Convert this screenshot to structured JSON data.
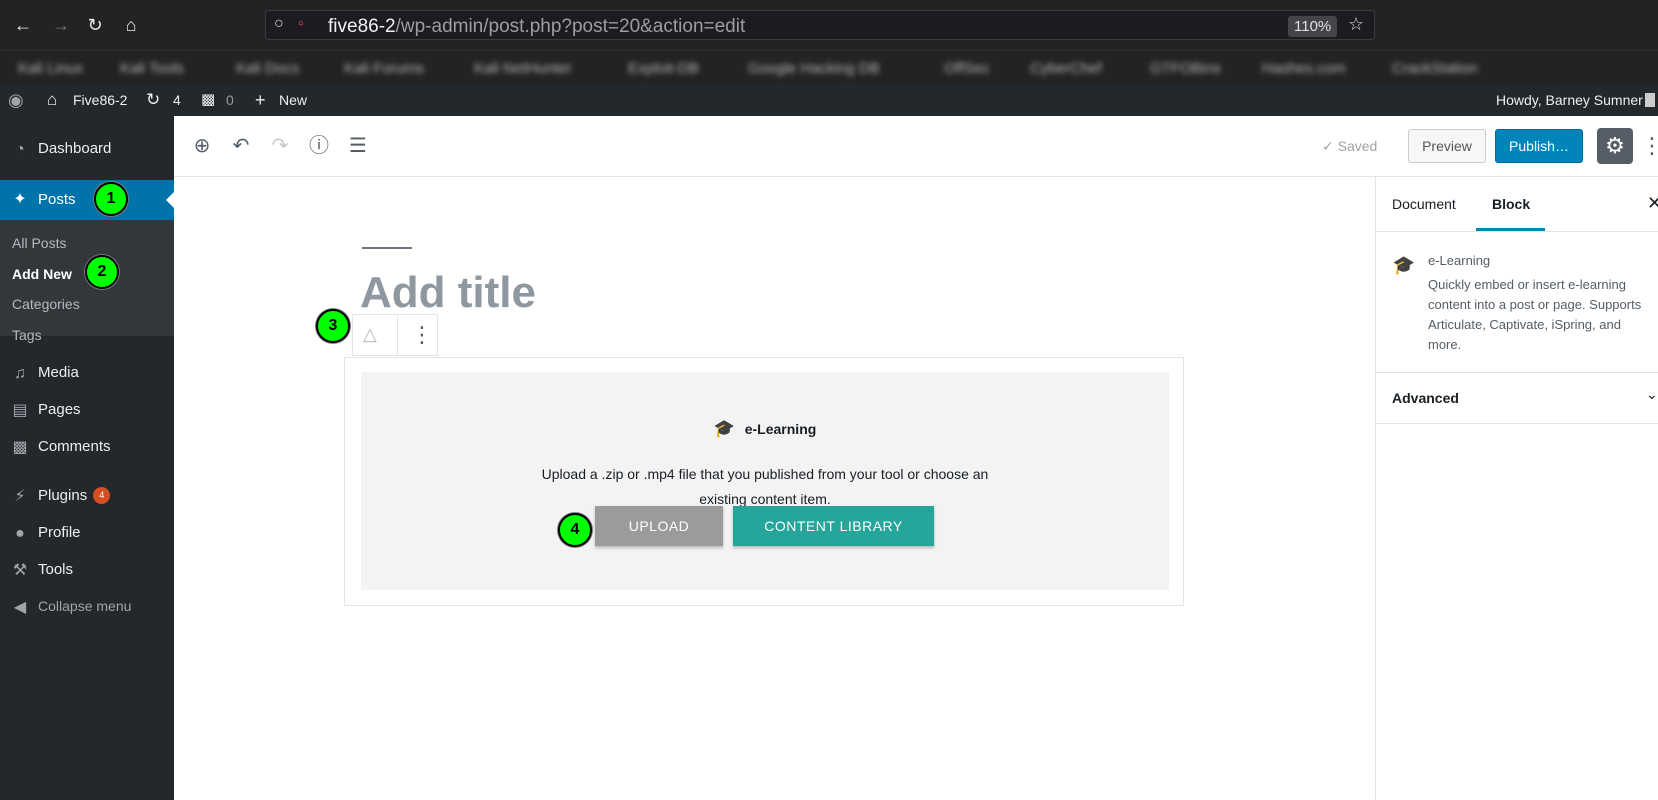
{
  "browser": {
    "url_host": "five86-2",
    "url_path": "/wp-admin/post.php?post=20&action=edit",
    "zoom": "110%",
    "bookmarks": [
      "Kali Linux",
      "Kali Tools",
      "Kali Docs",
      "Kali Forums",
      "Kali NetHunter",
      "Exploit-DB",
      "Google Hacking DB",
      "OffSec",
      "CyberChef",
      "GTFOBins",
      "Hashes.com",
      "CrackStation"
    ]
  },
  "adminbar": {
    "site_name": "Five86-2",
    "updates_count": "4",
    "comments_count": "0",
    "new_label": "New",
    "greeting": "Howdy, Barney Sumner"
  },
  "sidebar": {
    "dashboard": "Dashboard",
    "posts": "Posts",
    "submenu": [
      "All Posts",
      "Add New",
      "Categories",
      "Tags"
    ],
    "media": "Media",
    "pages": "Pages",
    "comments": "Comments",
    "plugins": "Plugins",
    "plugins_count": "4",
    "profile": "Profile",
    "tools": "Tools",
    "collapse": "Collapse menu"
  },
  "markers": [
    "1",
    "2",
    "3",
    "4"
  ],
  "toolbar": {
    "saved": "Saved",
    "preview": "Preview",
    "publish": "Publish…"
  },
  "editor": {
    "title_placeholder": "Add title",
    "block": {
      "name": "e-Learning",
      "description": "Upload a .zip or .mp4 file that you published from your tool or choose an existing content item.",
      "upload_label": "UPLOAD",
      "library_label": "CONTENT LIBRARY"
    }
  },
  "settings_panel": {
    "tab_document": "Document",
    "tab_block": "Block",
    "block_title": "e-Learning",
    "block_description_lines": [
      "Quickly embed or insert e-learning",
      "content into a post or page. Supports",
      "Articulate, Captivate, iSpring, and",
      "more."
    ],
    "advanced": "Advanced"
  },
  "colors": {
    "admin_dark": "#23282d",
    "wp_blue": "#0073aa",
    "publish_blue": "#0085ba",
    "teal": "#26a69a",
    "marker_green": "#00ff00"
  }
}
